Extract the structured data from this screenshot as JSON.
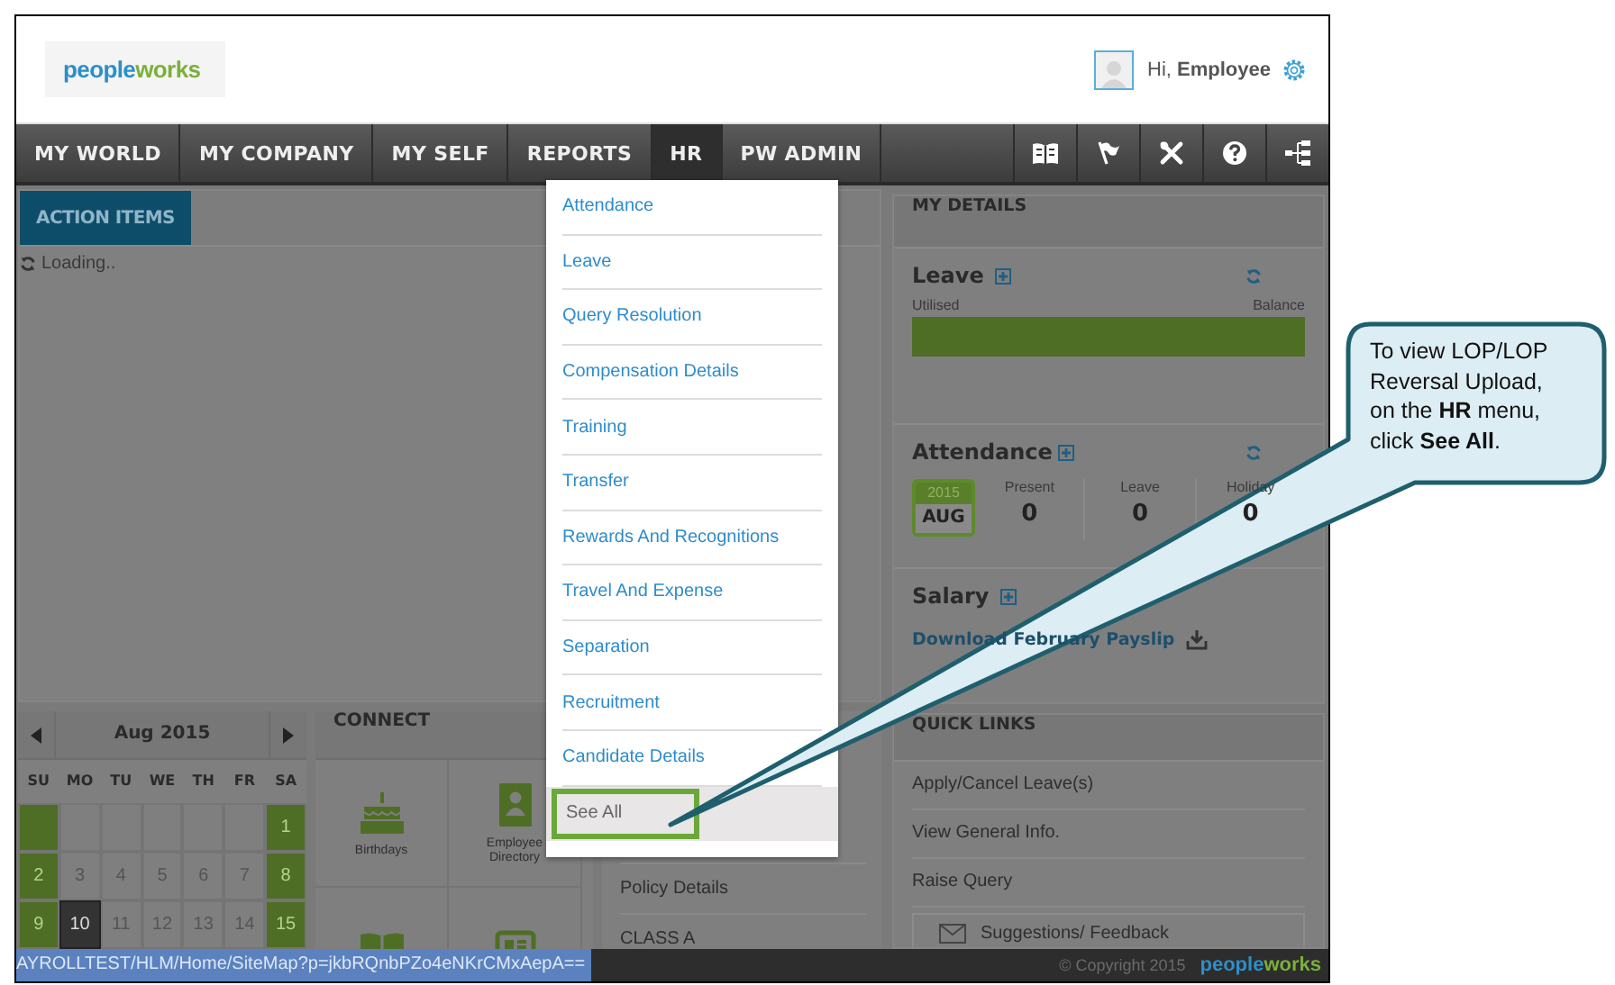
{
  "header": {
    "logo": "peopleworks",
    "greeting": "Hi, **Employee**"
  },
  "nav": {
    "items": [
      {
        "label": "MY WORLD",
        "selected": false
      },
      {
        "label": "MY COMPANY",
        "selected": false
      },
      {
        "label": "MY SELF",
        "selected": false
      },
      {
        "label": "REPORTS",
        "selected": false
      },
      {
        "label": "HR",
        "selected": true
      },
      {
        "label": "PW ADMIN",
        "selected": false
      }
    ],
    "tools": [
      {
        "kind": "book"
      },
      {
        "kind": "flag"
      },
      {
        "kind": "tools"
      },
      {
        "kind": "help"
      },
      {
        "kind": "sitemap"
      }
    ]
  },
  "hr_menu": {
    "items": [
      {
        "label": "Attendance",
        "selected": false
      },
      {
        "label": "Leave",
        "selected": false
      },
      {
        "label": "Query Resolution",
        "selected": false
      },
      {
        "label": "Compensation Details",
        "selected": false
      },
      {
        "label": "Training",
        "selected": false
      },
      {
        "label": "Transfer",
        "selected": false
      },
      {
        "label": "Rewards And Recognitions",
        "selected": false
      },
      {
        "label": "Travel And Expense",
        "selected": false
      },
      {
        "label": "Separation",
        "selected": false
      },
      {
        "label": "Recruitment",
        "selected": false
      },
      {
        "label": "Candidate Details",
        "selected": false
      },
      {
        "label": "See All",
        "selected": true
      }
    ]
  },
  "action_items": {
    "tab": "ACTION ITEMS",
    "status": "Loading.."
  },
  "calendar": {
    "month": "Aug 2015",
    "weekdays": [
      "SU",
      "MO",
      "TU",
      "WE",
      "TH",
      "FR",
      "SA"
    ],
    "weeks": [
      [
        {
          "day": "1",
          "selected": false
        }
      ],
      [
        {
          "day": "2",
          "selected": false
        },
        {
          "day": "3",
          "selected": false
        },
        {
          "day": "4",
          "selected": false
        },
        {
          "day": "5",
          "selected": false
        },
        {
          "day": "6",
          "selected": false
        },
        {
          "day": "7",
          "selected": false
        },
        {
          "day": "8",
          "selected": false
        }
      ],
      [
        {
          "day": "9",
          "selected": false
        },
        {
          "day": "10",
          "selected": true
        },
        {
          "day": "11",
          "selected": false
        },
        {
          "day": "12",
          "selected": false
        },
        {
          "day": "13",
          "selected": false
        },
        {
          "day": "14",
          "selected": false
        },
        {
          "day": "15",
          "selected": false
        }
      ]
    ]
  },
  "connect": {
    "title": "CONNECT",
    "tiles": [
      {
        "kind": "birthdays",
        "label": "Birthdays"
      },
      {
        "kind": "directory",
        "label": "Employee Directory"
      },
      {
        "kind": "book"
      },
      {
        "kind": "news"
      }
    ]
  },
  "policies": {
    "rows": [
      "Policy Details",
      "CLASS A"
    ]
  },
  "my_details": {
    "title": "MY DETAILS",
    "leave": {
      "title": "Leave",
      "left_label": "Utilised",
      "right_label": "Balance",
      "level": 1
    },
    "attendance": {
      "title": "Attendance",
      "year": "2015",
      "month": "AUG",
      "stats": [
        {
          "label": "Present",
          "value": "0"
        },
        {
          "label": "Leave",
          "value": "0"
        },
        {
          "label": "Holiday",
          "value": "0"
        }
      ]
    },
    "salary": {
      "title": "Salary",
      "link": "Download February Payslip"
    }
  },
  "quick_links": {
    "title": "QUICK LINKS",
    "links": [
      "Apply/Cancel Leave(s)",
      "View General Info.",
      "Raise Query"
    ],
    "feedback": "Suggestions/ Feedback"
  },
  "footer": {
    "status_url": "AYROLLTEST/HLM/Home/SiteMap?p=jkbRQnbPZo4eNKrCMxAepA==",
    "copyright": "© Copyright 2015",
    "logo": "peopleworks"
  },
  "callout": {
    "text": "To view LOP/LOP Reversal Upload, on the **HR** menu, click **See All**."
  }
}
